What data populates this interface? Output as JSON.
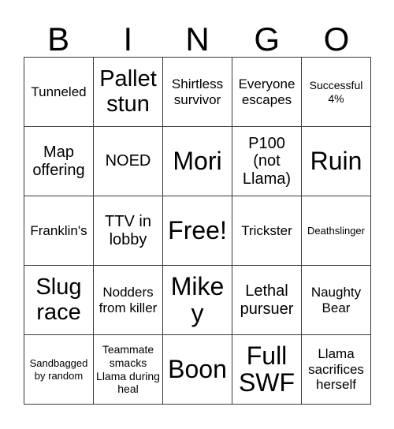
{
  "card": {
    "title": "BINGO",
    "header_letters": [
      "B",
      "I",
      "N",
      "G",
      "O"
    ],
    "colors": {
      "background": "#ffffff",
      "text": "#000000",
      "grid_line": "#3a3a3a"
    },
    "free_space": {
      "row": 2,
      "col": 2,
      "label": "Free!"
    },
    "rows": [
      [
        {
          "label": "Tunneled",
          "size": "sm"
        },
        {
          "label": "Pallet stun",
          "size": "lg"
        },
        {
          "label": "Shirtless survivor",
          "size": "sm"
        },
        {
          "label": "Everyone escapes",
          "size": "sm"
        },
        {
          "label": "Successful 4%",
          "size": "xs"
        }
      ],
      [
        {
          "label": "Map offering",
          "size": "md"
        },
        {
          "label": "NOED",
          "size": "md"
        },
        {
          "label": "Mori",
          "size": "xl"
        },
        {
          "label": "P100 (not Llama)",
          "size": "md"
        },
        {
          "label": "Ruin",
          "size": "xl"
        }
      ],
      [
        {
          "label": "Franklin's",
          "size": "sm"
        },
        {
          "label": "TTV in lobby",
          "size": "md"
        },
        {
          "label": "Free!",
          "size": "xl"
        },
        {
          "label": "Trickster",
          "size": "sm"
        },
        {
          "label": "Deathslinger",
          "size": "xxs"
        }
      ],
      [
        {
          "label": "Slug race",
          "size": "lg"
        },
        {
          "label": "Nodders from killer",
          "size": "sm"
        },
        {
          "label": "Mikey",
          "size": "xl"
        },
        {
          "label": "Lethal pursuer",
          "size": "md"
        },
        {
          "label": "Naughty Bear",
          "size": "sm"
        }
      ],
      [
        {
          "label": "Sandbagged by random",
          "size": "xxs"
        },
        {
          "label": "Teammate smacks Llama during heal",
          "size": "xs"
        },
        {
          "label": "Boon",
          "size": "xl"
        },
        {
          "label": "Full SWF",
          "size": "xl"
        },
        {
          "label": "Llama sacrifices herself",
          "size": "sm"
        }
      ]
    ]
  }
}
